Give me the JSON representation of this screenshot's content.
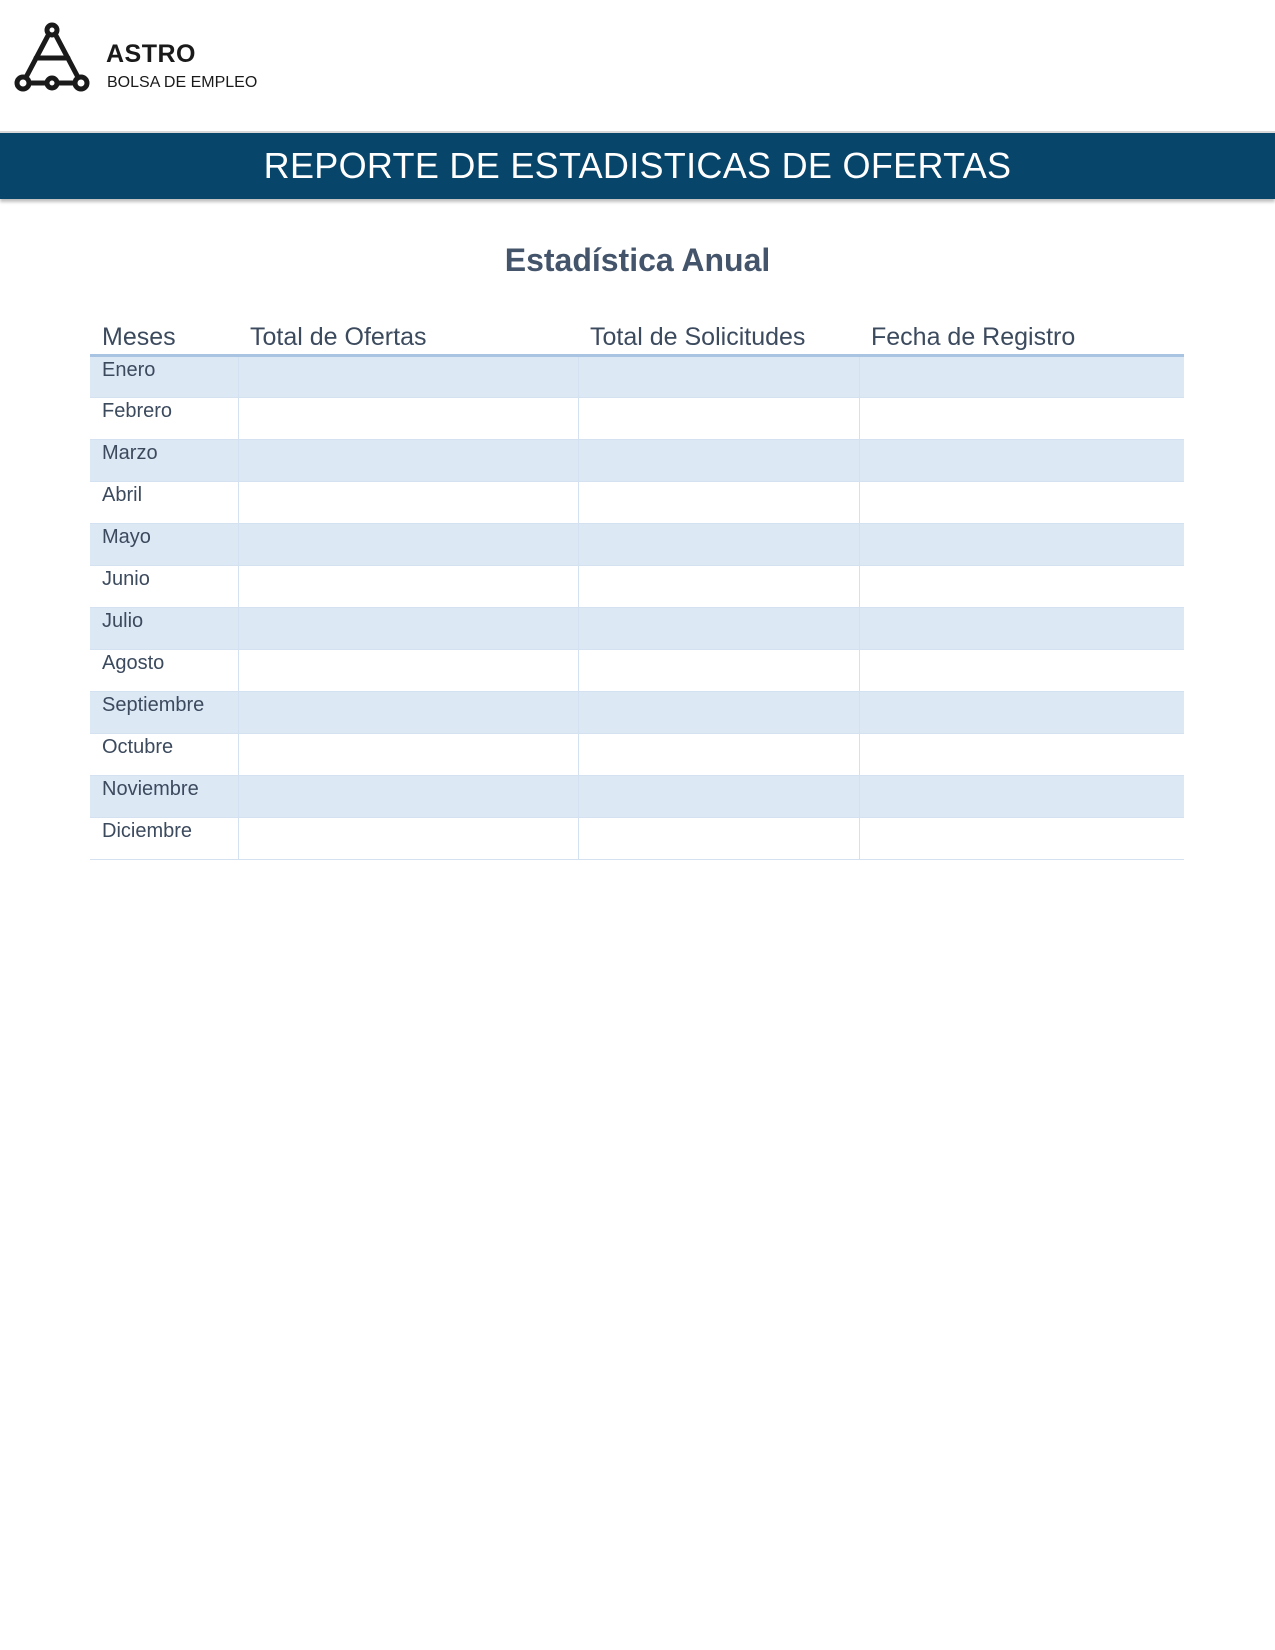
{
  "header": {
    "brand_name": "ASTRO",
    "brand_sub": "BOLSA DE EMPLEO",
    "banner_title": "REPORTE DE ESTADISTICAS DE OFERTAS"
  },
  "section": {
    "title": "Estadística Anual"
  },
  "table": {
    "columns": [
      "Meses",
      "Total de Ofertas",
      "Total de Solicitudes",
      "Fecha de Registro"
    ],
    "rows": [
      {
        "mes": "Enero",
        "ofertas": "",
        "solicitudes": "",
        "fecha": ""
      },
      {
        "mes": "Febrero",
        "ofertas": "",
        "solicitudes": "",
        "fecha": ""
      },
      {
        "mes": "Marzo",
        "ofertas": "",
        "solicitudes": "",
        "fecha": ""
      },
      {
        "mes": "Abril",
        "ofertas": "",
        "solicitudes": "",
        "fecha": ""
      },
      {
        "mes": "Mayo",
        "ofertas": "",
        "solicitudes": "",
        "fecha": ""
      },
      {
        "mes": "Junio",
        "ofertas": "",
        "solicitudes": "",
        "fecha": ""
      },
      {
        "mes": "Julio",
        "ofertas": "",
        "solicitudes": "",
        "fecha": ""
      },
      {
        "mes": "Agosto",
        "ofertas": "",
        "solicitudes": "",
        "fecha": ""
      },
      {
        "mes": "Septiembre",
        "ofertas": "",
        "solicitudes": "",
        "fecha": ""
      },
      {
        "mes": "Octubre",
        "ofertas": "",
        "solicitudes": "",
        "fecha": ""
      },
      {
        "mes": "Noviembre",
        "ofertas": "",
        "solicitudes": "",
        "fecha": ""
      },
      {
        "mes": "Diciembre",
        "ofertas": "",
        "solicitudes": "",
        "fecha": ""
      }
    ]
  },
  "colors": {
    "banner": "#07456a",
    "text": "#44546a",
    "row_band": "#dde8f5",
    "header_rule": "#a9c3e2"
  }
}
